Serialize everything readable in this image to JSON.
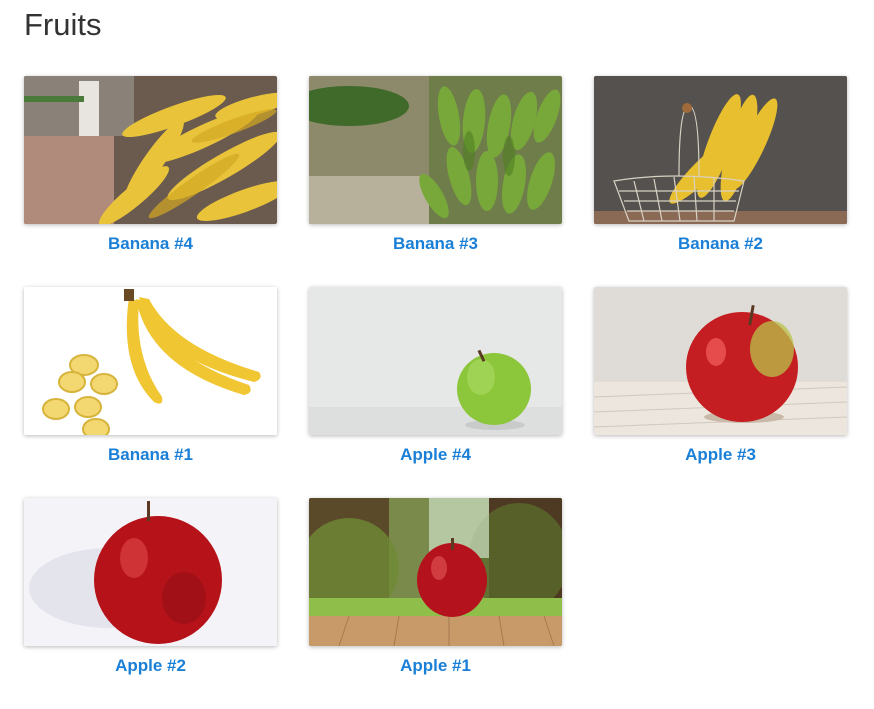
{
  "page": {
    "title": "Fruits"
  },
  "gallery": {
    "items": [
      {
        "label": "Banana #4",
        "image": "banana-market-display"
      },
      {
        "label": "Banana #3",
        "image": "green-banana-bunch"
      },
      {
        "label": "Banana #2",
        "image": "bananas-in-wire-basket"
      },
      {
        "label": "Banana #1",
        "image": "bananas-with-slices"
      },
      {
        "label": "Apple #4",
        "image": "green-apple-on-white"
      },
      {
        "label": "Apple #3",
        "image": "red-apple-on-wood"
      },
      {
        "label": "Apple #2",
        "image": "red-apple-on-white"
      },
      {
        "label": "Apple #1",
        "image": "red-apple-in-forest"
      }
    ]
  },
  "colors": {
    "link": "#1a7fd6",
    "title": "#333333"
  }
}
